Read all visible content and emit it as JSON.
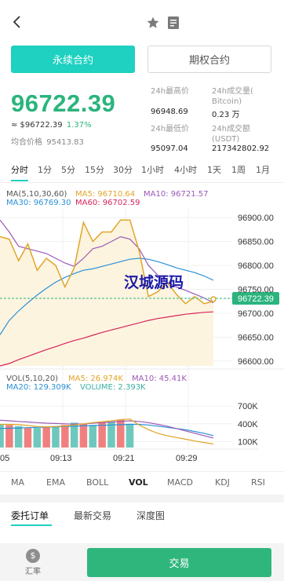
{
  "tabs": {
    "perpetual": "永续合约",
    "options": "期权合约"
  },
  "ticker": {
    "last_price": "96722.39",
    "approx_price": "≈ $96722.39",
    "change_pct": "1.37%",
    "avg_label": "均合价格",
    "avg_value": "95413.83"
  },
  "stats": {
    "high_label": "24h最高价",
    "high_value": "96948.69",
    "low_label": "24h最低价",
    "low_value": "95097.04",
    "volume_label_1": "24h成交量(",
    "volume_label_2": "Bitcoin)",
    "volume_value": "0.23 万",
    "turnover_label_1": "24h成交额",
    "turnover_label_2": "(USDT)",
    "turnover_value": "217342802.92"
  },
  "periods": [
    "分时",
    "1分",
    "5分",
    "15分",
    "30分",
    "1小时",
    "4小时",
    "1天",
    "1周",
    "1月"
  ],
  "main_legend": {
    "ma_params": "MA(5,10,30,60)",
    "ma5": "MA5: 96710.64",
    "ma10": "MA10: 96721.57",
    "ma30": "MA30: 96769.30",
    "ma60": "MA60: 96702.59"
  },
  "vol_legend": {
    "vol_params": "VOL(5,10,20)",
    "ma5": "MA5: 26.974K",
    "ma10": "MA10: 45.41K",
    "ma20": "MA20: 129.309K",
    "volume": "VOLUME: 2.393K"
  },
  "price_axis": [
    "96900.00",
    "96850.00",
    "96800.00",
    "96750.00",
    "96700.00",
    "96650.00",
    "96600.00"
  ],
  "vol_axis": [
    "700K",
    "400K",
    "100K"
  ],
  "time_axis": [
    "05",
    "09:13",
    "09:21",
    "09:29"
  ],
  "current_price_tag": "96722.39",
  "watermark": "汉城源码",
  "indicators": [
    "MA",
    "EMA",
    "BOLL",
    "VOL",
    "MACD",
    "KDJ",
    "RSI"
  ],
  "order_tabs": [
    "委托订单",
    "最新交易",
    "深度图"
  ],
  "bottom": {
    "rate_label": "汇率",
    "rate_symbol": "$",
    "trade_label": "交易"
  },
  "colors": {
    "accent": "#1ed1c0",
    "up": "#2bb47d",
    "ma5": "#e0a526",
    "ma10": "#9b59b6",
    "ma30": "#2a90d8",
    "ma60": "#d6245a",
    "vol_up": "#f08080",
    "vol_down": "#6fc8bd"
  },
  "chart_data": [
    {
      "type": "line",
      "title": "",
      "ylim": [
        96590,
        96920
      ],
      "x": [
        "05",
        "09:13",
        "09:21",
        "09:29"
      ],
      "series": [
        {
          "name": "MA5",
          "values": [
            96860,
            96855,
            96810,
            96845,
            96790,
            96815,
            96800,
            96755,
            96795,
            96890,
            96850,
            96870,
            96870,
            96895,
            96895,
            96830,
            96735,
            96745,
            96765,
            96740,
            96720,
            96735,
            96720,
            96725
          ]
        },
        {
          "name": "MA10",
          "values": [
            96895,
            96870,
            96840,
            96835,
            96830,
            96825,
            96815,
            96805,
            96798,
            96815,
            96835,
            96840,
            96850,
            96860,
            96855,
            96835,
            96800,
            96780,
            96765,
            96755,
            96748,
            96740,
            96732,
            96722
          ]
        },
        {
          "name": "MA30",
          "values": [
            96655,
            96685,
            96705,
            96722,
            96738,
            96752,
            96765,
            96775,
            96783,
            96790,
            96793,
            96798,
            96803,
            96808,
            96813,
            96815,
            96813,
            96808,
            96802,
            96795,
            96790,
            96785,
            96778,
            96769
          ]
        },
        {
          "name": "MA60",
          "values": [
            96590,
            96595,
            96603,
            96610,
            96617,
            96624,
            96630,
            96637,
            96643,
            96648,
            96654,
            96660,
            96665,
            96670,
            96675,
            96680,
            96685,
            96689,
            96692,
            96695,
            96698,
            96700,
            96702,
            96703
          ]
        }
      ]
    },
    {
      "type": "bar",
      "title": "",
      "ylim": [
        0,
        900
      ],
      "series": [
        {
          "name": "VOL",
          "values": [
            390,
            380,
            360,
            330,
            330,
            350,
            360,
            380,
            420,
            400,
            380,
            420,
            430,
            470,
            400,
            0,
            0,
            0,
            0,
            0,
            0,
            0,
            0,
            0
          ]
        },
        {
          "name": "MA5",
          "values": [
            390,
            390,
            385,
            370,
            355,
            350,
            355,
            362,
            380,
            400,
            420,
            435,
            450,
            470,
            480,
            380,
            300,
            240,
            200,
            170,
            140,
            110,
            85,
            60
          ]
        },
        {
          "name": "MA10",
          "values": [
            460,
            450,
            440,
            430,
            420,
            410,
            405,
            400,
            395,
            398,
            410,
            420,
            430,
            440,
            450,
            440,
            420,
            390,
            360,
            320,
            280,
            240,
            200,
            160
          ]
        },
        {
          "name": "MA20",
          "values": [
            320,
            325,
            330,
            335,
            340,
            345,
            350,
            355,
            360,
            365,
            370,
            375,
            380,
            385,
            390,
            390,
            380,
            360,
            340,
            320,
            300,
            270,
            240,
            200
          ]
        }
      ]
    }
  ]
}
